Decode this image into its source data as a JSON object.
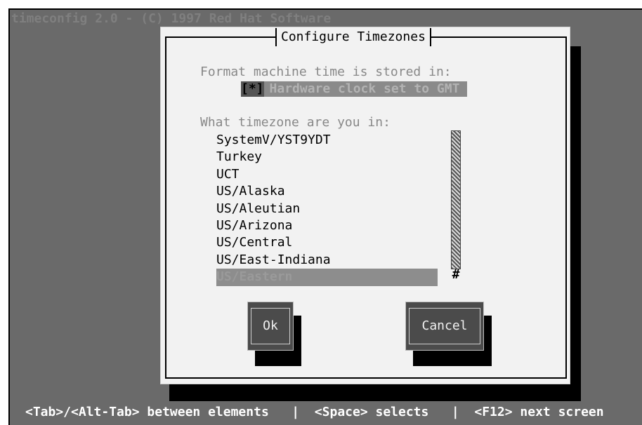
{
  "root": {
    "title": "timeconfig 2.0 - (C) 1997 Red Hat Software"
  },
  "dialog": {
    "title": "Configure Timezones",
    "format_label": "Format machine time is stored in:",
    "checkbox": {
      "mark": "[*]",
      "label": "Hardware clock set to GMT",
      "checked": true
    },
    "timezone_label": "What timezone are you in:",
    "timezones": [
      "SystemV/YST9YDT",
      "Turkey",
      "UCT",
      "US/Alaska",
      "US/Aleutian",
      "US/Arizona",
      "US/Central",
      "US/East-Indiana",
      "US/Eastern"
    ],
    "selected_timezone": "US/Eastern",
    "scroll_thumb_glyph": "#",
    "ok_label": "Ok",
    "cancel_label": "Cancel"
  },
  "status_bar": {
    "text": "<Tab>/<Alt-Tab> between elements   |  <Space> selects   |  <F12> next screen"
  },
  "colors": {
    "background": "#6a6a6a",
    "dialog": "#f2f2f2",
    "selection": "#8d8d8d",
    "button": "#4b4b4b"
  }
}
